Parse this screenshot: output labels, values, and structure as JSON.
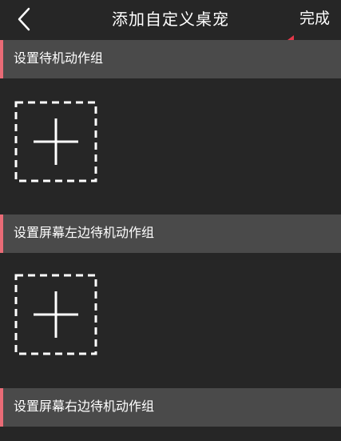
{
  "nav": {
    "title": "添加自定义桌宠",
    "done_label": "完成",
    "back_icon": "chevron-left-icon"
  },
  "annotation": {
    "arrow_color": "#e5384a",
    "icon": "red-arrow-pointer"
  },
  "sections": [
    {
      "label": "设置待机动作组",
      "add_icon": "plus-icon"
    },
    {
      "label": "设置屏幕左边待机动作组",
      "add_icon": "plus-icon"
    },
    {
      "label": "设置屏幕右边待机动作组"
    }
  ],
  "colors": {
    "background": "#262626",
    "header_background": "#4a4a4a",
    "accent": "#e96b76",
    "text": "#ffffff"
  }
}
